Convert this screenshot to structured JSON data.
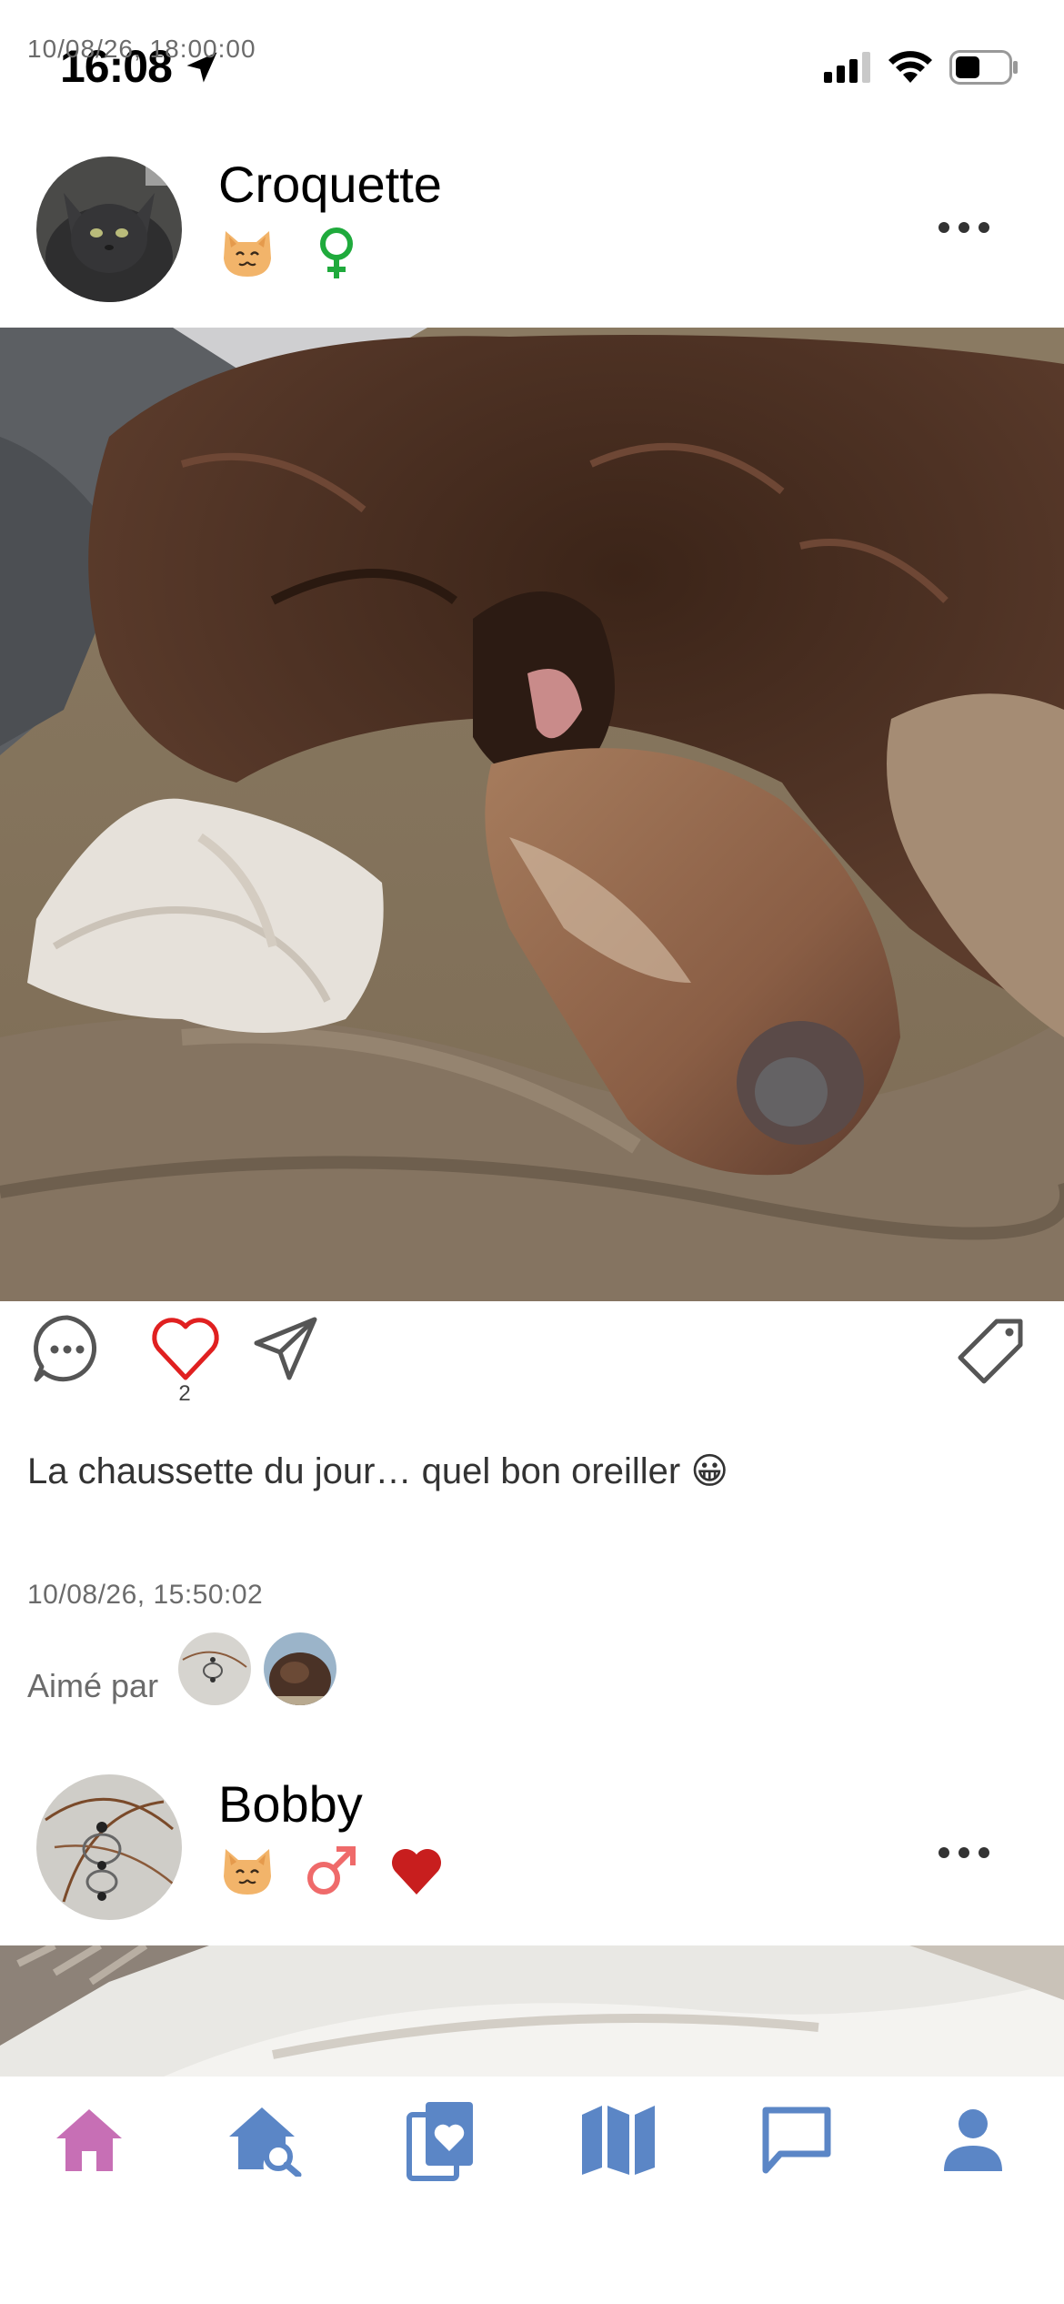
{
  "status_bar": {
    "overlay_timestamp": "10/08/26, 18:00:00",
    "time": "16:08",
    "icons": [
      "location-arrow-icon",
      "cellular-signal-icon",
      "wifi-icon",
      "battery-icon"
    ]
  },
  "posts": [
    {
      "author": "Croquette",
      "species_icon": "cat-face-icon",
      "sex_icon": "female-symbol-icon",
      "photo_subject": "dog",
      "like_count": "2",
      "caption": "La chaussette du jour… quel bon oreiller 😀",
      "date": "10/08/26, 15:50:02",
      "liked_by_label": "Aimé par",
      "likers": [
        "avatar-1",
        "avatar-2"
      ]
    },
    {
      "author": "Bobby",
      "species_icon": "cat-face-icon",
      "sex_icon": "male-symbol-icon",
      "extra_icon": "heart-icon"
    }
  ],
  "tabbar": {
    "tabs": [
      {
        "name": "home",
        "icon": "home-icon",
        "active": true
      },
      {
        "name": "search",
        "icon": "house-search-icon",
        "active": false
      },
      {
        "name": "album",
        "icon": "photo-album-heart-icon",
        "active": false
      },
      {
        "name": "map",
        "icon": "map-icon",
        "active": false
      },
      {
        "name": "messages",
        "icon": "chat-bubble-icon",
        "active": false
      },
      {
        "name": "profile",
        "icon": "person-icon",
        "active": false
      }
    ]
  },
  "colors": {
    "active_tab": "#c76fb5",
    "inactive_tab": "#5b86c6",
    "female": "#1faa3c",
    "male": "#ef6a6a",
    "like_red": "#e02020",
    "heart_badge": "#c81e1e",
    "cat_face": "#f2b46a"
  }
}
